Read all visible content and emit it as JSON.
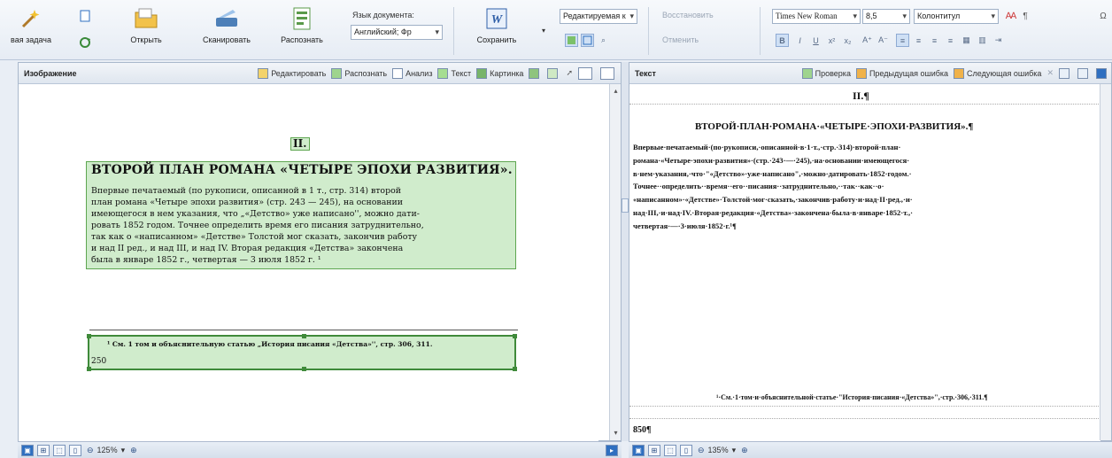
{
  "ribbon": {
    "new_task_label": "вая задача",
    "open_label": "Открыть",
    "scan_label": "Сканировать",
    "recognize_label": "Распознать",
    "doc_lang_label": "Язык документа:",
    "doc_lang_value": "Английский; Фр",
    "save_label": "Сохранить",
    "mode_value": "Редактируемая к",
    "restore_label": "Восстановить",
    "cancel_label": "Отменить",
    "font_value": "Times New Roman",
    "size_value": "8,5",
    "style_value": "Колонтитул"
  },
  "image_pane": {
    "title": "Изображение",
    "tools": [
      "Редактировать",
      "Распознать",
      "Анализ",
      "Текст",
      "Картинка"
    ],
    "page_number": "II.",
    "heading": "ВТОРОЙ ПЛАН РОМАНА «ЧЕТЫРЕ ЭПОХИ РАЗВИТИЯ».",
    "body_lines": [
      "Впервые печатаемый (по рукописи, описанной в 1 т., стр. 314) второй",
      "план романа «Четыре эпохи развития» (стр. 243 — 245), на основании",
      "имеющегося в нем указания, что „«Детство» уже написано'', можно дати-",
      "ровать 1852 годом. Точнее определить время его писания затруднительно,",
      "так как о «написанном» «Детстве» Толстой мог сказать, закончив работу",
      "и над II ред., и над III, и над IV. Вторая редакция «Детства» закончена",
      "была в январе 1852 г., четвертая — 3 июля 1852 г. ¹"
    ],
    "footnote": "¹ См. 1 том и объяснительную статью „История писания «Детства»'', стр. 306, 311.",
    "page_num_bottom": "250",
    "zoom": "125%"
  },
  "text_pane": {
    "title": "Текст",
    "tools": [
      "Проверка",
      "Предыдущая ошибка",
      "Следующая ошибка"
    ],
    "page_number": "II.¶",
    "heading": "ВТОРОЙ·ПЛАН·РОМАНА·«ЧЕТЫРЕ·ЭПОХИ·РАЗВИТИЯ».¶",
    "body_lines": [
      "Впервые·печатаемый·(по·рукописи,·описанной·в·1·т.,·стр.·314)·второй·план·",
      "романа·«Четыре·эпохи·развития»·(стр.·243·—·245),·на·основании·имеющегося·",
      "в·нем·указания,·что·\"«Детство»·уже·написано\",·можно·датировать·1852·годом.·",
      "Точнее··определить··время··его··писания··затруднительно,··так··как··о·",
      "«написанном»·«Детстве»·Толстой·мог·сказать,·закончив·работу·и·над·II·ред.,·и·",
      "над·III,·и·над·IV.·Вторая·редакция·«Детства»·закончена·была·в·январе·1852·т.,·",
      "четвертая·—·3·июля·1852·г.¹¶"
    ],
    "footnote": "¹·См.·1·том·и·объяснительной·статье·\"История·писания·«Детства»\",·стр.·306,·311.¶",
    "page_num_bottom": "850¶",
    "zoom": "135%"
  }
}
